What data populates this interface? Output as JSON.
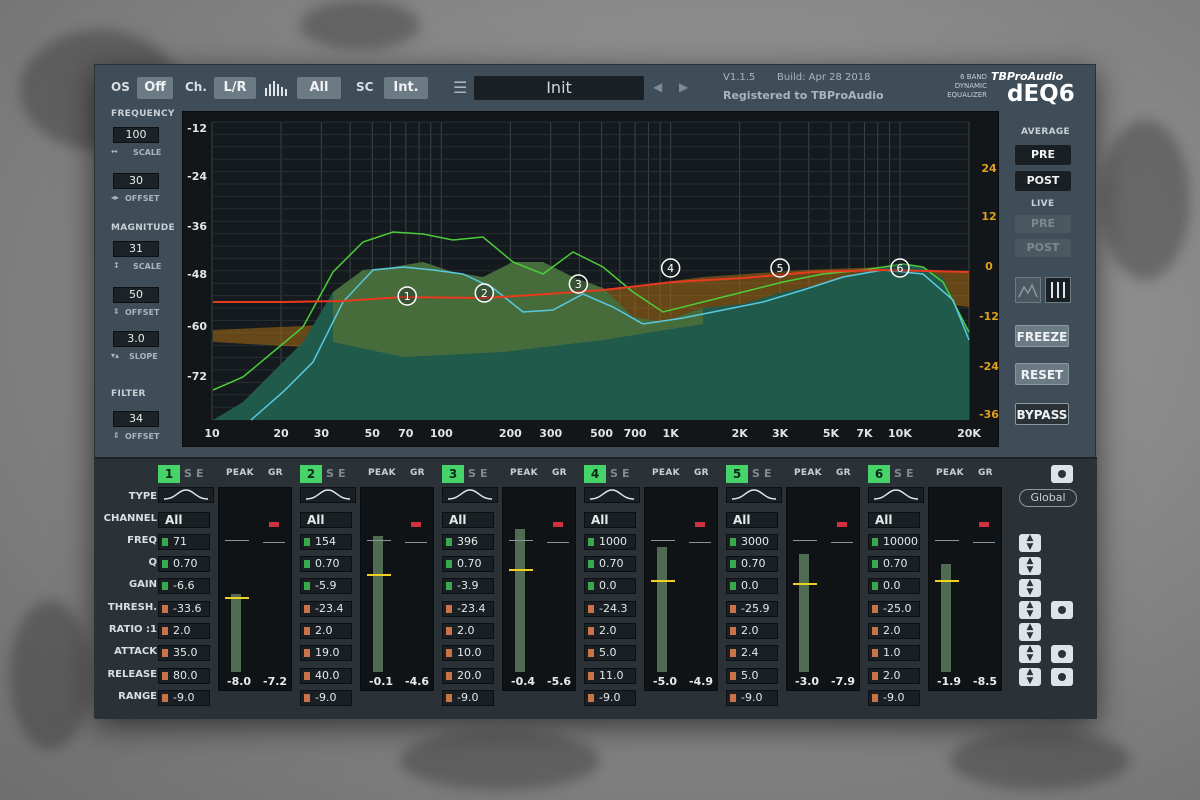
{
  "header": {
    "os_label": "OS",
    "os_value": "Off",
    "ch_label": "Ch.",
    "ch_value": "L/R",
    "bands_value": "All",
    "sc_label": "SC",
    "sc_value": "Int.",
    "preset": "Init",
    "version": "V1.1.5",
    "build": "Build: Apr 28 2018",
    "registered": "Registered to TBProAudio",
    "band_desc1": "6 BAND",
    "band_desc2": "DYNAMIC",
    "band_desc3": "EQUALIZER",
    "brand": "TBProAudio",
    "product": "dEQ6"
  },
  "left": {
    "frequency_label": "FREQUENCY",
    "freq_scale": "100",
    "scale_label": "SCALE",
    "freq_offset": "30",
    "offset_label": "OFFSET",
    "magnitude_label": "MAGNITUDE",
    "mag_scale": "31",
    "mag_scale_label": "SCALE",
    "mag_offset": "50",
    "mag_offset_label": "OFFSET",
    "slope": "3.0",
    "slope_label": "SLOPE",
    "filter_label": "FILTER",
    "filter_value": "34",
    "filter_offset_label": "OFFSET"
  },
  "right": {
    "average_label": "AVERAGE",
    "pre": "PRE",
    "post": "POST",
    "live_label": "LIVE",
    "live_pre": "PRE",
    "live_post": "POST",
    "freeze": "FREEZE",
    "reset": "RESET",
    "bypass": "BYPASS",
    "global": "Global"
  },
  "graph": {
    "left_ticks": [
      "-12",
      "-24",
      "-36",
      "-48",
      "-60",
      "-72"
    ],
    "right_ticks": [
      "24",
      "12",
      "0",
      "-12",
      "-24",
      "-36"
    ],
    "x_ticks": [
      "10",
      "20",
      "30",
      "50",
      "70",
      "100",
      "200",
      "300",
      "500",
      "700",
      "1K",
      "2K",
      "3K",
      "5K",
      "7K",
      "10K",
      "20K"
    ],
    "nodes": [
      "1",
      "2",
      "3",
      "4",
      "5",
      "6"
    ]
  },
  "rows": [
    "TYPE",
    "CHANNEL",
    "FREQ",
    "Q",
    "GAIN",
    "THRESH.",
    "RATIO :1",
    "ATTACK",
    "RELEASE",
    "RANGE"
  ],
  "band_header": {
    "s": "S",
    "e": "E",
    "peak": "PEAK",
    "gr": "GR"
  },
  "bands": [
    {
      "num": "1",
      "channel": "All",
      "freq": "71",
      "q": "0.70",
      "gain": "-6.6",
      "thresh": "-33.6",
      "ratio": "2.0",
      "attack": "35.0",
      "release": "80.0",
      "range": "-9.0",
      "peak": "-8.0",
      "gr": "-7.2"
    },
    {
      "num": "2",
      "channel": "All",
      "freq": "154",
      "q": "0.70",
      "gain": "-5.9",
      "thresh": "-23.4",
      "ratio": "2.0",
      "attack": "19.0",
      "release": "40.0",
      "range": "-9.0",
      "peak": "-0.1",
      "gr": "-4.6"
    },
    {
      "num": "3",
      "channel": "All",
      "freq": "396",
      "q": "0.70",
      "gain": "-3.9",
      "thresh": "-23.4",
      "ratio": "2.0",
      "attack": "10.0",
      "release": "20.0",
      "range": "-9.0",
      "peak": "-0.4",
      "gr": "-5.6"
    },
    {
      "num": "4",
      "channel": "All",
      "freq": "1000",
      "q": "0.70",
      "gain": "0.0",
      "thresh": "-24.3",
      "ratio": "2.0",
      "attack": "5.0",
      "release": "11.0",
      "range": "-9.0",
      "peak": "-5.0",
      "gr": "-4.9"
    },
    {
      "num": "5",
      "channel": "All",
      "freq": "3000",
      "q": "0.70",
      "gain": "0.0",
      "thresh": "-25.9",
      "ratio": "2.0",
      "attack": "2.4",
      "release": "5.0",
      "range": "-9.0",
      "peak": "-3.0",
      "gr": "-7.9"
    },
    {
      "num": "6",
      "channel": "All",
      "freq": "10000",
      "q": "0.70",
      "gain": "0.0",
      "thresh": "-25.0",
      "ratio": "2.0",
      "attack": "1.0",
      "release": "2.0",
      "range": "-9.0",
      "peak": "-1.9",
      "gr": "-8.5"
    }
  ]
}
